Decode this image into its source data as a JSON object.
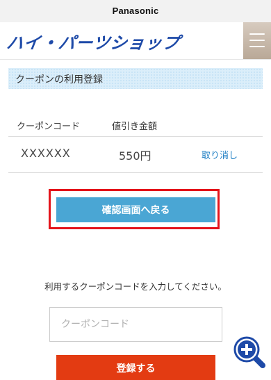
{
  "header": {
    "brand": "Panasonic",
    "logo_text": "ハイ・パーツショップ",
    "menu_icon": "hamburger-menu-icon"
  },
  "section": {
    "title": "クーポンの利用登録"
  },
  "coupon_table": {
    "headers": [
      "クーポンコード",
      "値引き金額"
    ],
    "rows": [
      {
        "code": "XXXXXX",
        "amount": "550円",
        "action": "取り消し"
      }
    ]
  },
  "back_button": {
    "label": "確認画面へ戻る"
  },
  "instruction": "利用するクーポンコードを入力してください。",
  "coupon_input": {
    "placeholder": "クーポンコード",
    "value": ""
  },
  "register_button": {
    "label": "登録する"
  },
  "zoom_icon": "zoom-in-icon",
  "colors": {
    "logo": "#1e4aa8",
    "link": "#1f7fc4",
    "back_button": "#4aa6d4",
    "register_button": "#e33b12",
    "highlight": "#e4141b"
  }
}
